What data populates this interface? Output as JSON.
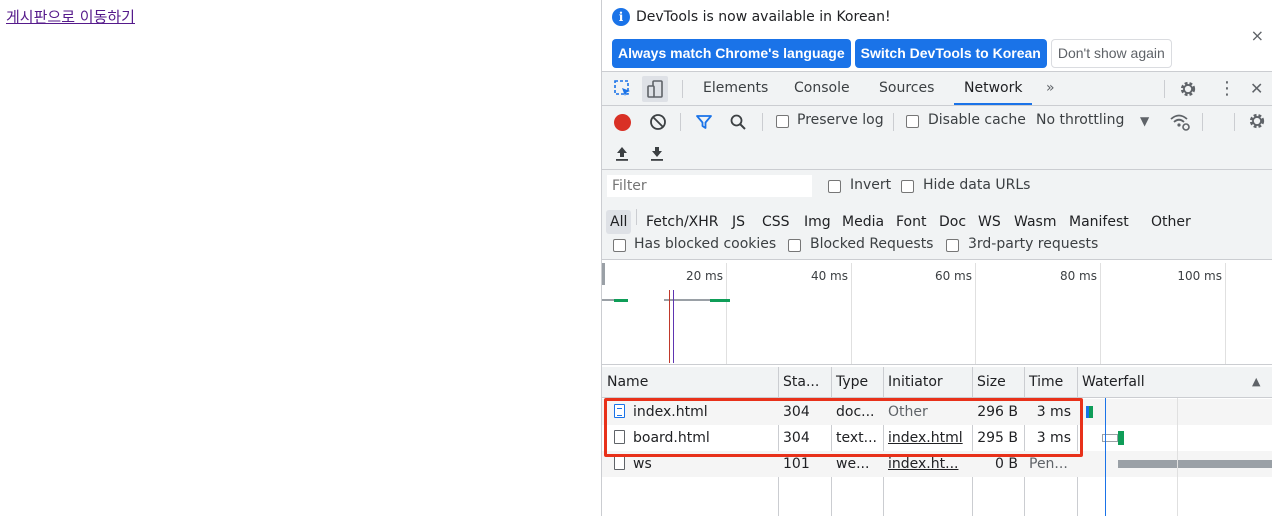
{
  "page": {
    "link_text": "게시판으로 이동하기"
  },
  "infobar": {
    "icon": "info-icon",
    "message": "DevTools is now available in Korean!",
    "btn_match": "Always match Chrome's language",
    "btn_switch": "Switch DevTools to Korean",
    "btn_dont_show": "Don't show again",
    "close": "×"
  },
  "tabs": {
    "items": [
      "Elements",
      "Console",
      "Sources",
      "Network"
    ],
    "selected": "Network",
    "more": "»",
    "kebab": "⋮",
    "close": "✕"
  },
  "network_toolbar": {
    "preserve_log": "Preserve log",
    "disable_cache": "Disable cache",
    "throttling": "No throttling",
    "throttle_arrow": "▼"
  },
  "filter": {
    "placeholder": "Filter",
    "invert": "Invert",
    "hide_data_urls": "Hide data URLs",
    "types": [
      "All",
      "Fetch/XHR",
      "JS",
      "CSS",
      "Img",
      "Media",
      "Font",
      "Doc",
      "WS",
      "Wasm",
      "Manifest",
      "Other"
    ],
    "selected_type": "All",
    "has_blocked_cookies": "Has blocked cookies",
    "blocked_requests": "Blocked Requests",
    "third_party": "3rd-party requests"
  },
  "overview": {
    "ticks": [
      "20 ms",
      "40 ms",
      "60 ms",
      "80 ms",
      "100 ms"
    ]
  },
  "table": {
    "columns": [
      "Name",
      "Sta...",
      "Type",
      "Initiator",
      "Size",
      "Time",
      "Waterfall"
    ],
    "sort_arrow": "▲",
    "rows": [
      {
        "name": "index.html",
        "status": "304",
        "type": "doc...",
        "initiator": "Other",
        "size": "296 B",
        "time": "3 ms"
      },
      {
        "name": "board.html",
        "status": "304",
        "type": "text...",
        "initiator": "index.html",
        "size": "295 B",
        "time": "3 ms"
      },
      {
        "name": "ws",
        "status": "101",
        "type": "we...",
        "initiator": "index.ht...",
        "size": "0 B",
        "time": "Pen..."
      }
    ]
  },
  "colors": {
    "accent": "#1a73e8",
    "highlight": "#e8311a",
    "record": "#d93025"
  }
}
